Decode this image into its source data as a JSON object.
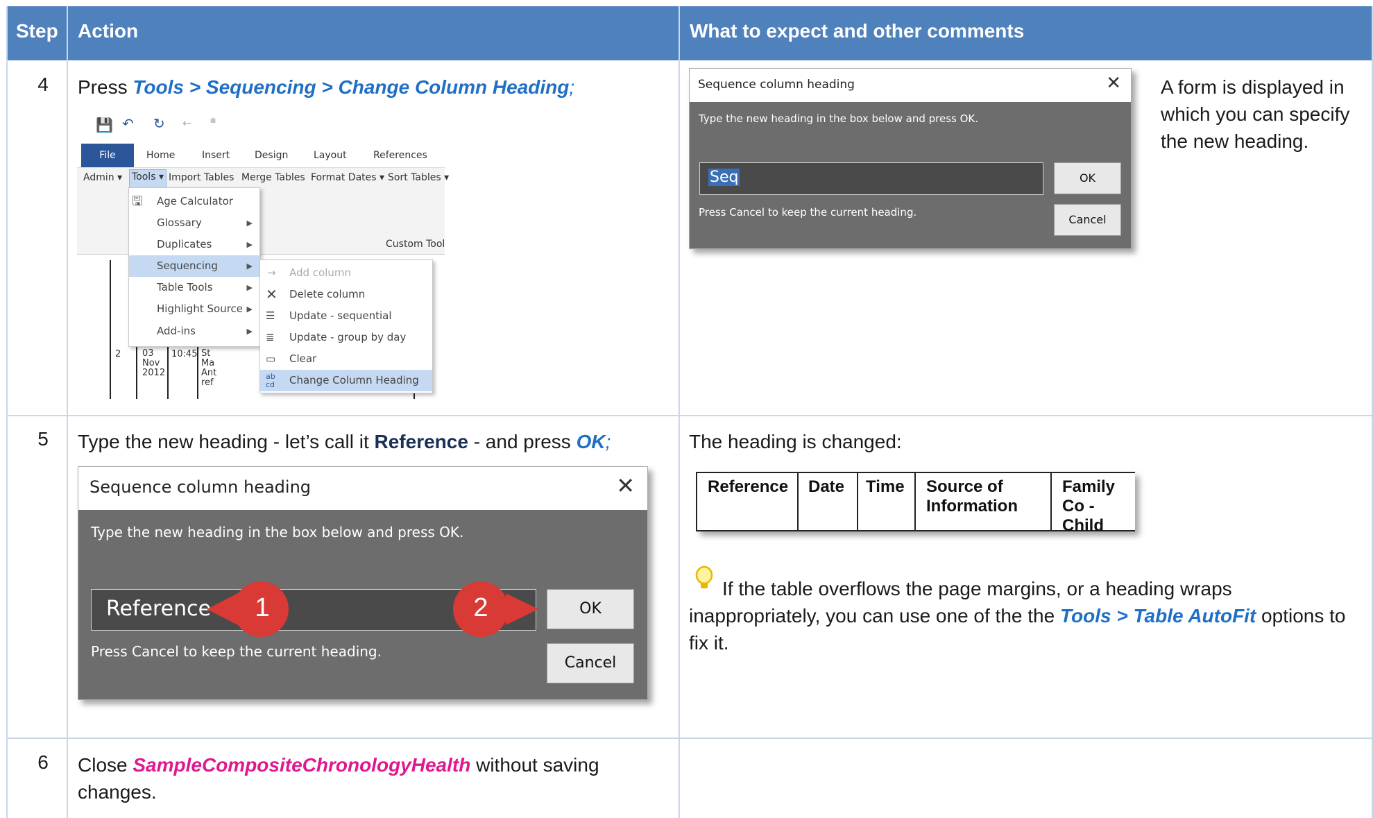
{
  "header": {
    "step": "Step",
    "action": "Action",
    "expect": "What to expect and other comments"
  },
  "rows": [
    {
      "step": "4",
      "action_prefix": "Press ",
      "action_path": "Tools > Sequencing > Change Column Heading",
      "action_suffix": ";",
      "expect": "A form is displayed in which you can specify the new heading."
    },
    {
      "step": "5",
      "action_prefix": "Type the new heading - let’s call it ",
      "action_bold": "Reference",
      "action_mid": " - and press ",
      "action_ok": "OK",
      "action_suffix": ";",
      "expect_intro": "The heading is changed:",
      "tip_text_prefix": "If the table overflows the page margins, or a heading wraps inappropriately, you can use one of the the ",
      "tip_path": "Tools > Table AutoFit",
      "tip_text_suffix": " options to fix it."
    },
    {
      "step": "6",
      "action_prefix": "Close ",
      "action_file": "SampleCompositeChronologyHealth",
      "action_suffix": " without saving changes."
    }
  ],
  "dialog_small": {
    "title": "Sequence column heading",
    "message": "Type the new heading in the box below and press OK.",
    "input_value": "Seq",
    "ok": "OK",
    "cancel": "Cancel",
    "hint": "Press Cancel to keep the current heading."
  },
  "dialog_large": {
    "title": "Sequence column heading",
    "message": "Type the new heading in the box below and press OK.",
    "input_value": "Reference",
    "ok": "OK",
    "cancel": "Cancel",
    "hint": "Press Cancel to keep the current heading.",
    "callout_1": "1",
    "callout_2": "2"
  },
  "word_ui": {
    "tabs": [
      "File",
      "Home",
      "Insert",
      "Design",
      "Layout",
      "References"
    ],
    "ribbon": [
      "Admin ▾",
      "Tools ▾",
      "Import Tables",
      "Merge Tables",
      "Format Dates ▾",
      "Sort Tables ▾"
    ],
    "group_label": "Custom Tool",
    "tools_menu": [
      "Age Calculator",
      "Glossary",
      "Duplicates",
      "Sequencing",
      "Table Tools",
      "Highlight Source",
      "Add-ins"
    ],
    "seq_menu": [
      "Add column",
      "Delete column",
      "Update - sequential",
      "Update - group by day",
      "Clear",
      "Change Column Heading"
    ],
    "doc_cells": {
      "row": "2",
      "date": "03\nNov\n2012",
      "time": "10:45",
      "src": "St\nMa\nAnt\nref"
    }
  },
  "result_table": {
    "headers": [
      "Reference",
      "Date",
      "Time",
      "Source of Information",
      "Family Co - Child"
    ]
  },
  "colors": {
    "header_bg": "#4f81bd",
    "link_blue": "#1f6fc6",
    "file_magenta": "#e0188f"
  }
}
